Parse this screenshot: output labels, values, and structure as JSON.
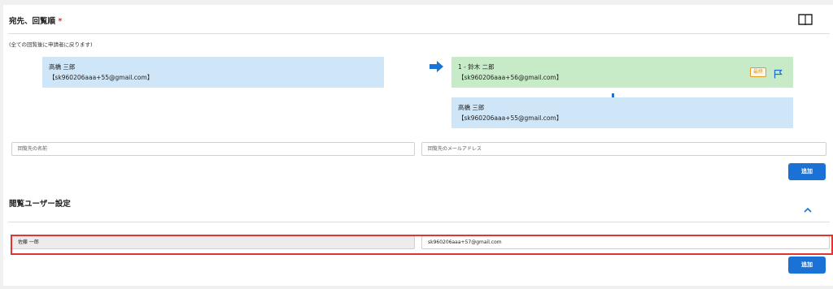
{
  "recipients_section": {
    "title": "宛先、回覧順",
    "required_mark": "*",
    "note": "(全ての回覧後に申請者に戻ります)",
    "left_box": {
      "name": "高橋 三郎",
      "email": "【sk960206aaa+55@gmail.com】"
    },
    "route": [
      {
        "name": "1 - 鈴木 二郎",
        "email": "【sk960206aaa+56@gmail.com】",
        "badge": "最終"
      },
      {
        "name": "高橋 三郎",
        "email": "【sk960206aaa+55@gmail.com】"
      }
    ],
    "name_input_placeholder": "回覧先の名前",
    "email_input_placeholder": "回覧先のメールアドレス",
    "add_button": "追加"
  },
  "viewer_section": {
    "title": "閲覧ユーザー設定",
    "row": {
      "name": "佐藤 一郎",
      "email": "sk960206aaa+57@gmail.com"
    },
    "add_button": "追加"
  },
  "colors": {
    "accent": "#1a72d6",
    "highlight": "#e13531"
  },
  "icons": [
    "book-icon",
    "arrow-right-icon",
    "arrow-down-icon",
    "flag-icon",
    "chevron-up-icon"
  ]
}
